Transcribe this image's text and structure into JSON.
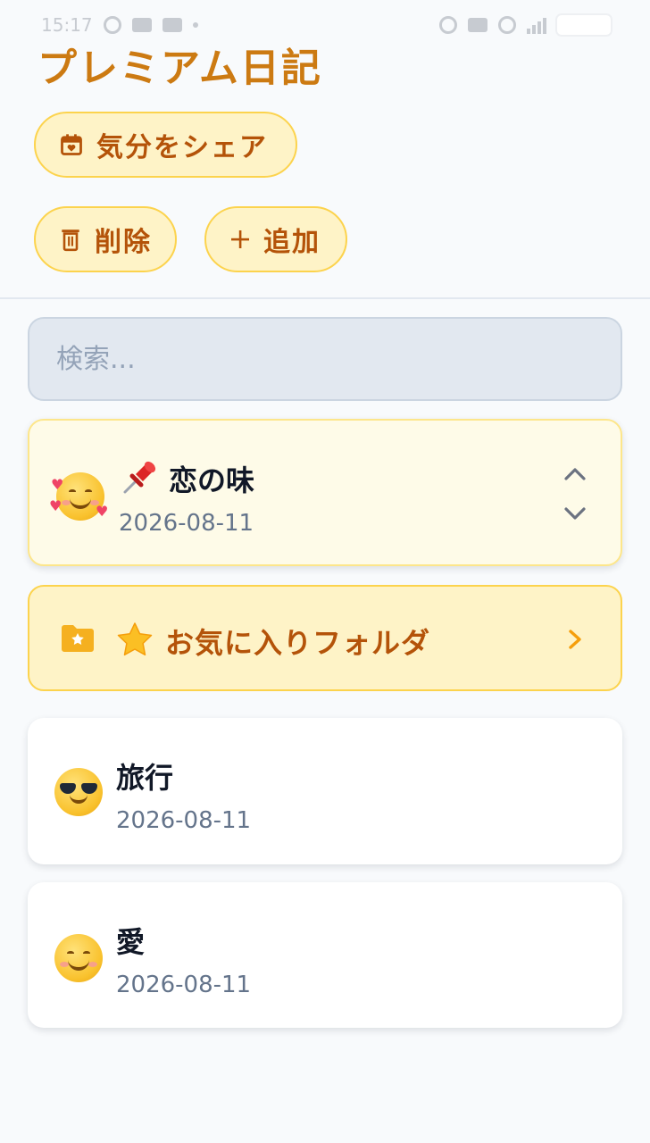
{
  "status_bar": {
    "time": "15:17"
  },
  "header": {
    "title": "プレミアム日記",
    "share_label": "気分をシェア",
    "delete_label": "削除",
    "add_label": "追加"
  },
  "search": {
    "placeholder": "検索..."
  },
  "pinned_entry": {
    "title": "恋の味",
    "date": "2026-08-11",
    "emoji": "smiling-face-with-hearts",
    "pin_icon": "pushpin-icon"
  },
  "favorites_folder": {
    "label": "お気に入りフォルダ",
    "icon": "folder-star-icon",
    "star_icon": "star-icon"
  },
  "entries": [
    {
      "title": "旅行",
      "date": "2026-08-11",
      "emoji": "sunglasses-face"
    },
    {
      "title": "愛",
      "date": "2026-08-11",
      "emoji": "smiling-face"
    }
  ],
  "colors": {
    "accent": "#cc7a12",
    "pill_bg": "#fef3c7",
    "pill_border": "#fcd34d",
    "page_bg": "#f8fafc",
    "text_muted": "#64748b"
  }
}
